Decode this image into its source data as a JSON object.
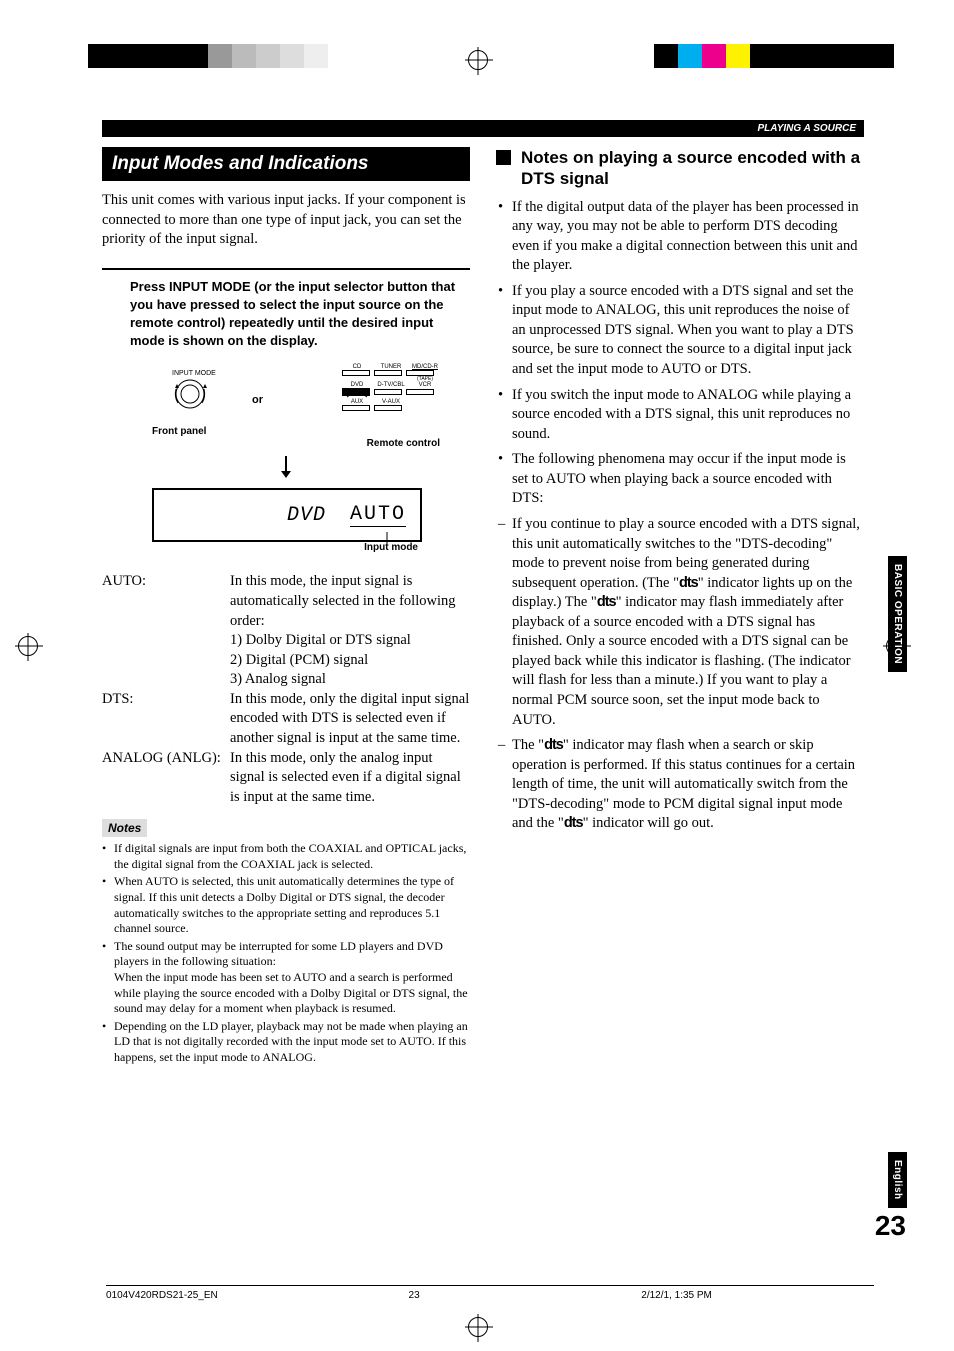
{
  "header": {
    "running": "PLAYING A SOURCE"
  },
  "left": {
    "title": "Input Modes and Indications",
    "intro": "This unit comes with various input jacks. If your component is connected to more than one type of input jack, you can set the priority of the input signal.",
    "instruction": "Press INPUT MODE (or the input selector button that you have pressed to select the input source on the remote control) repeatedly until the desired input mode is shown on the display.",
    "diagram": {
      "input_mode_label": "INPUT MODE",
      "or": "or",
      "front_panel": "Front panel",
      "remote_control": "Remote control",
      "remote_buttons": {
        "row1": [
          "CD",
          "TUNER",
          "MD/CD-R"
        ],
        "row1_sub": "(TAPE)",
        "row2": [
          "DVD",
          "D-TV/CBL",
          "VCR"
        ],
        "row3": [
          "AUX",
          "V-AUX"
        ]
      },
      "display_left": "DVD",
      "display_right": "AUTO",
      "input_mode_caption": "Input mode"
    },
    "modes": {
      "auto_term": "AUTO:",
      "auto_def": "In this mode, the input signal is automatically selected in the following order:",
      "auto_1": "1) Dolby Digital or DTS signal",
      "auto_2": "2) Digital (PCM) signal",
      "auto_3": "3) Analog signal",
      "dts_term": "DTS:",
      "dts_def": "In this mode, only the digital input signal encoded with DTS is selected even if another signal is input at the same time.",
      "analog_term": "ANALOG (ANLG):",
      "analog_def": "In this mode, only the analog input signal is selected even if a digital signal is input at the same time."
    },
    "notes_header": "Notes",
    "notes": [
      "If digital signals are input from both the COAXIAL and OPTICAL jacks, the digital signal from the COAXIAL jack is selected.",
      "When AUTO is selected, this unit automatically determines the type of signal. If this unit detects a Dolby Digital or DTS signal, the decoder automatically switches to the appropriate setting and reproduces 5.1 channel source.",
      "The sound output may be interrupted for some LD players and DVD players in the following situation:\nWhen the input mode has been set to AUTO and a search is performed while playing the source encoded with a Dolby Digital or DTS signal, the sound may delay for a moment when playback is resumed.",
      "Depending on the LD player, playback may not be made when playing an LD that is not digitally recorded with the input mode set to AUTO. If this happens, set the input mode to ANALOG."
    ]
  },
  "right": {
    "heading": "Notes on playing a source encoded with a DTS signal",
    "bullets": [
      "If the digital output data of the player has been processed in any way, you may not be able to perform DTS decoding even if you make a digital connection between this unit and the player.",
      "If you play a source encoded with a DTS signal and set the input mode to ANALOG, this unit reproduces the noise of an unprocessed DTS signal. When you want to play a DTS source, be sure to connect the source to a digital input jack and set the input mode to AUTO or DTS.",
      "If you switch the input mode to ANALOG while playing a source encoded with a DTS signal, this unit reproduces no sound.",
      "The following phenomena may occur if the input mode is set to AUTO when playing back a source encoded with DTS:"
    ],
    "dashes": [
      "If you continue to play a source encoded with a DTS signal, this unit automatically switches to the \"DTS-decoding\" mode to prevent noise from being generated during subsequent operation. (The \"dts\" indicator lights up on the display.) The \"dts\" indicator may flash immediately after playback of a source encoded with a DTS signal has finished. Only a source encoded with a DTS signal can be played back while this indicator is flashing. (The indicator will flash for less than a minute.) If you want to play a normal PCM source soon, set the input mode back to AUTO.",
      "The \"dts\" indicator may flash when a search or skip operation is performed. If this status continues for a certain length of time, the unit will automatically switch from the \"DTS-decoding\" mode to PCM digital signal input mode and the \"dts\" indicator will go out."
    ]
  },
  "side_tabs": {
    "operation": "BASIC OPERATION",
    "language": "English"
  },
  "page_number": "23",
  "footer": {
    "left": "0104V420RDS21-25_EN",
    "center": "23",
    "right": "2/12/1, 1:35 PM"
  }
}
